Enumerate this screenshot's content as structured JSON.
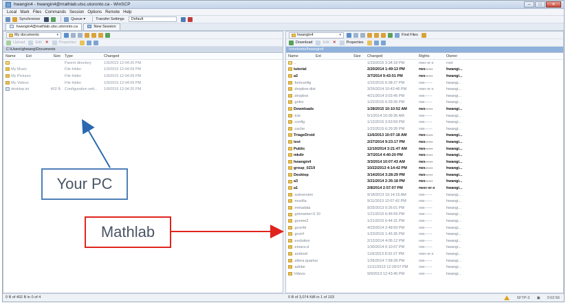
{
  "window": {
    "title": "hwangin4 - hwangin4@mathlab.utsc.utoronto.ca - WinSCP",
    "controls": [
      "–",
      "□",
      "✕"
    ]
  },
  "menu": [
    "Local",
    "Mark",
    "Files",
    "Commands",
    "Session",
    "Options",
    "Remote",
    "Help"
  ],
  "main_toolbar": {
    "synchronize": "Synchronize",
    "queue": "Queue ▾",
    "transfer_settings": "Transfer Settings",
    "transfer_default": "Default"
  },
  "tabs": [
    {
      "label": "hwangin4@mathlab.utsc.utoronto.ca"
    },
    {
      "label": "New Session"
    }
  ],
  "local": {
    "drive": "My documents",
    "actions": {
      "upload": "Upload",
      "edit": "Edit",
      "properties": "Properties"
    },
    "path": "C:\\Users\\ghwang\\Documents",
    "columns": {
      "name": "Name",
      "ext": "Ext",
      "size": "Size",
      "type": "Type",
      "changed": "Changed"
    },
    "rows": [
      {
        "name": "..",
        "size": "",
        "type": "Parent directory",
        "changed": "1/9/2015 12:04:20 PM",
        "icon": "up"
      },
      {
        "name": "My Music",
        "size": "",
        "type": "File folder",
        "changed": "1/9/2015 12:04:09 PM",
        "icon": "folder"
      },
      {
        "name": "My Pictures",
        "size": "",
        "type": "File folder",
        "changed": "1/9/2015 12:04:09 PM",
        "icon": "folder"
      },
      {
        "name": "My Videos",
        "size": "",
        "type": "File folder",
        "changed": "1/9/2015 12:04:09 PM",
        "icon": "folder"
      },
      {
        "name": "desktop.ini",
        "size": "402 B",
        "type": "Configuration sett...",
        "changed": "1/9/2015 12:04:20 PM",
        "icon": "doc"
      }
    ]
  },
  "remote": {
    "drive": "hwangin4",
    "find_files": "Find Files",
    "actions": {
      "download": "Download",
      "edit": "Edit",
      "properties": "Properties"
    },
    "path": "/cmshome/hwangin4",
    "columns": {
      "name": "Name",
      "ext": "Ext",
      "size": "Size",
      "changed": "Changed",
      "rights": "Rights",
      "owner": "Owner"
    },
    "rows": [
      {
        "name": "..",
        "changed": "1/23/2015 3:34:18 PM",
        "rights": "rwxr-xr-x",
        "owner": "root",
        "strong": false
      },
      {
        "name": "tutorial",
        "changed": "2/20/2014 1:49:13 PM",
        "rights": "rwx------",
        "owner": "hwangi...",
        "strong": true
      },
      {
        "name": "a2",
        "changed": "3/7/2014 9:43:01 PM",
        "rights": "rwx------",
        "owner": "hwangi...",
        "strong": true
      },
      {
        "name": ".fontconfig",
        "changed": "1/22/2015 6:38:27 PM",
        "rights": "rwx------",
        "owner": "hwangi...",
        "strong": false
      },
      {
        "name": ".dropbox-dist",
        "changed": "3/26/2014 10:42:46 PM",
        "rights": "rwxr-xr-x",
        "owner": "hwangi...",
        "strong": false
      },
      {
        "name": ".dropbox",
        "changed": "4/21/2014 3:03:45 PM",
        "rights": "rwx------",
        "owner": "hwangi...",
        "strong": false
      },
      {
        "name": ".gnfsv",
        "changed": "1/22/2015 6:29:35 PM",
        "rights": "rwx------",
        "owner": "hwangi...",
        "strong": false
      },
      {
        "name": "Downloads",
        "changed": "1/28/2015 10:10:52 AM",
        "rights": "rwx------",
        "owner": "hwangi...",
        "strong": true
      },
      {
        "name": ".tcle",
        "changed": "5/1/2014 10:09:35 AM",
        "rights": "rwx------",
        "owner": "hwangi...",
        "strong": false
      },
      {
        "name": ".config",
        "changed": "1/12/2015 3:53:59 PM",
        "rights": "rwx------",
        "owner": "hwangi...",
        "strong": false
      },
      {
        "name": ".cache",
        "changed": "1/22/2015 6:29:35 PM",
        "rights": "rwx------",
        "owner": "hwangi...",
        "strong": false
      },
      {
        "name": "TriageDroid",
        "changed": "11/6/2013 10:07:18 AM",
        "rights": "rwx------",
        "owner": "hwangi...",
        "strong": true
      },
      {
        "name": "test",
        "changed": "2/27/2014 9:23:17 PM",
        "rights": "rwx------",
        "owner": "hwangi...",
        "strong": true
      },
      {
        "name": "Public",
        "changed": "12/10/2014 3:21:47 AM",
        "rights": "rwx------",
        "owner": "hwangi...",
        "strong": true
      },
      {
        "name": "mkdir",
        "changed": "3/7/2014 4:40:20 PM",
        "rights": "rwx------",
        "owner": "hwangi...",
        "strong": true
      },
      {
        "name": "hwangin4",
        "changed": "3/3/2014 10:07:43 AM",
        "rights": "rwx------",
        "owner": "hwangi...",
        "strong": true
      },
      {
        "name": "group_0Z19",
        "changed": "10/22/2013 4:14:42 PM",
        "rights": "rwx------",
        "owner": "hwangi...",
        "strong": true
      },
      {
        "name": "Desktop",
        "changed": "3/14/2014 3:28:29 PM",
        "rights": "rwx------",
        "owner": "hwangi...",
        "strong": true
      },
      {
        "name": "a3",
        "changed": "3/21/2014 2:35:18 PM",
        "rights": "rwx------",
        "owner": "hwangi...",
        "strong": true
      },
      {
        "name": "a1",
        "changed": "2/8/2014 2:57:07 PM",
        "rights": "rwxr-xr-x",
        "owner": "hwangi...",
        "strong": true
      },
      {
        "name": ".subversion",
        "changed": "9/18/2013 10:14:15 AM",
        "rights": "rwx------",
        "owner": "hwangi...",
        "strong": false
      },
      {
        "name": ".mozilla",
        "changed": "9/11/2013 12:07:42 PM",
        "rights": "rwx------",
        "owner": "hwangi...",
        "strong": false
      },
      {
        "name": ".metadata",
        "changed": "9/25/2013 5:26:01 PM",
        "rights": "rwx------",
        "owner": "hwangi...",
        "strong": false
      },
      {
        "name": ".gstreamer-0.10",
        "changed": "1/21/2015 6:46:59 PM",
        "rights": "rwx------",
        "owner": "hwangi...",
        "strong": false
      },
      {
        "name": ".gnome2",
        "changed": "1/21/2015 6:44:31 PM",
        "rights": "rwx------",
        "owner": "hwangi...",
        "strong": false
      },
      {
        "name": ".gconfd",
        "changed": "4/23/2014 2:48:59 PM",
        "rights": "rwx------",
        "owner": "hwangi...",
        "strong": false
      },
      {
        "name": ".gconf",
        "changed": "1/23/2015 1:45:35 PM",
        "rights": "rwx------",
        "owner": "hwangi...",
        "strong": false
      },
      {
        "name": ".evolution",
        "changed": "2/12/2014 4:05:12 PM",
        "rights": "rwx------",
        "owner": "hwangi...",
        "strong": false
      },
      {
        "name": ".emacs.d",
        "changed": "1/30/2014 6:10:07 PM",
        "rights": "rwx------",
        "owner": "hwangi...",
        "strong": false
      },
      {
        "name": ".android",
        "changed": "11/6/2013 8:32:27 PM",
        "rights": "rwxr-xr-x",
        "owner": "hwangi...",
        "strong": false
      },
      {
        "name": ".altera.quartus",
        "changed": "1/26/2014 7:58:28 PM",
        "rights": "rwx------",
        "owner": "hwangi...",
        "strong": false
      },
      {
        "name": ".adobe",
        "changed": "11/11/2013 12:28:07 PM",
        "rights": "rwx------",
        "owner": "hwangi...",
        "strong": false
      },
      {
        "name": "Videos",
        "changed": "9/9/2013 12:43:45 PM",
        "rights": "rwx------",
        "owner": "hwangi...",
        "strong": false
      }
    ]
  },
  "status": {
    "left": "0 B of 402 B in 0 of 4",
    "right": "0 B of 3,074 KiB in 1 of 103",
    "protocol": "SFTP-3",
    "time": "0:02:56"
  },
  "annotations": {
    "pc_label": "Your PC",
    "mathlab_label": "Mathlab",
    "pc_color": "#4d7fb8",
    "mathlab_color": "#e0231d"
  }
}
